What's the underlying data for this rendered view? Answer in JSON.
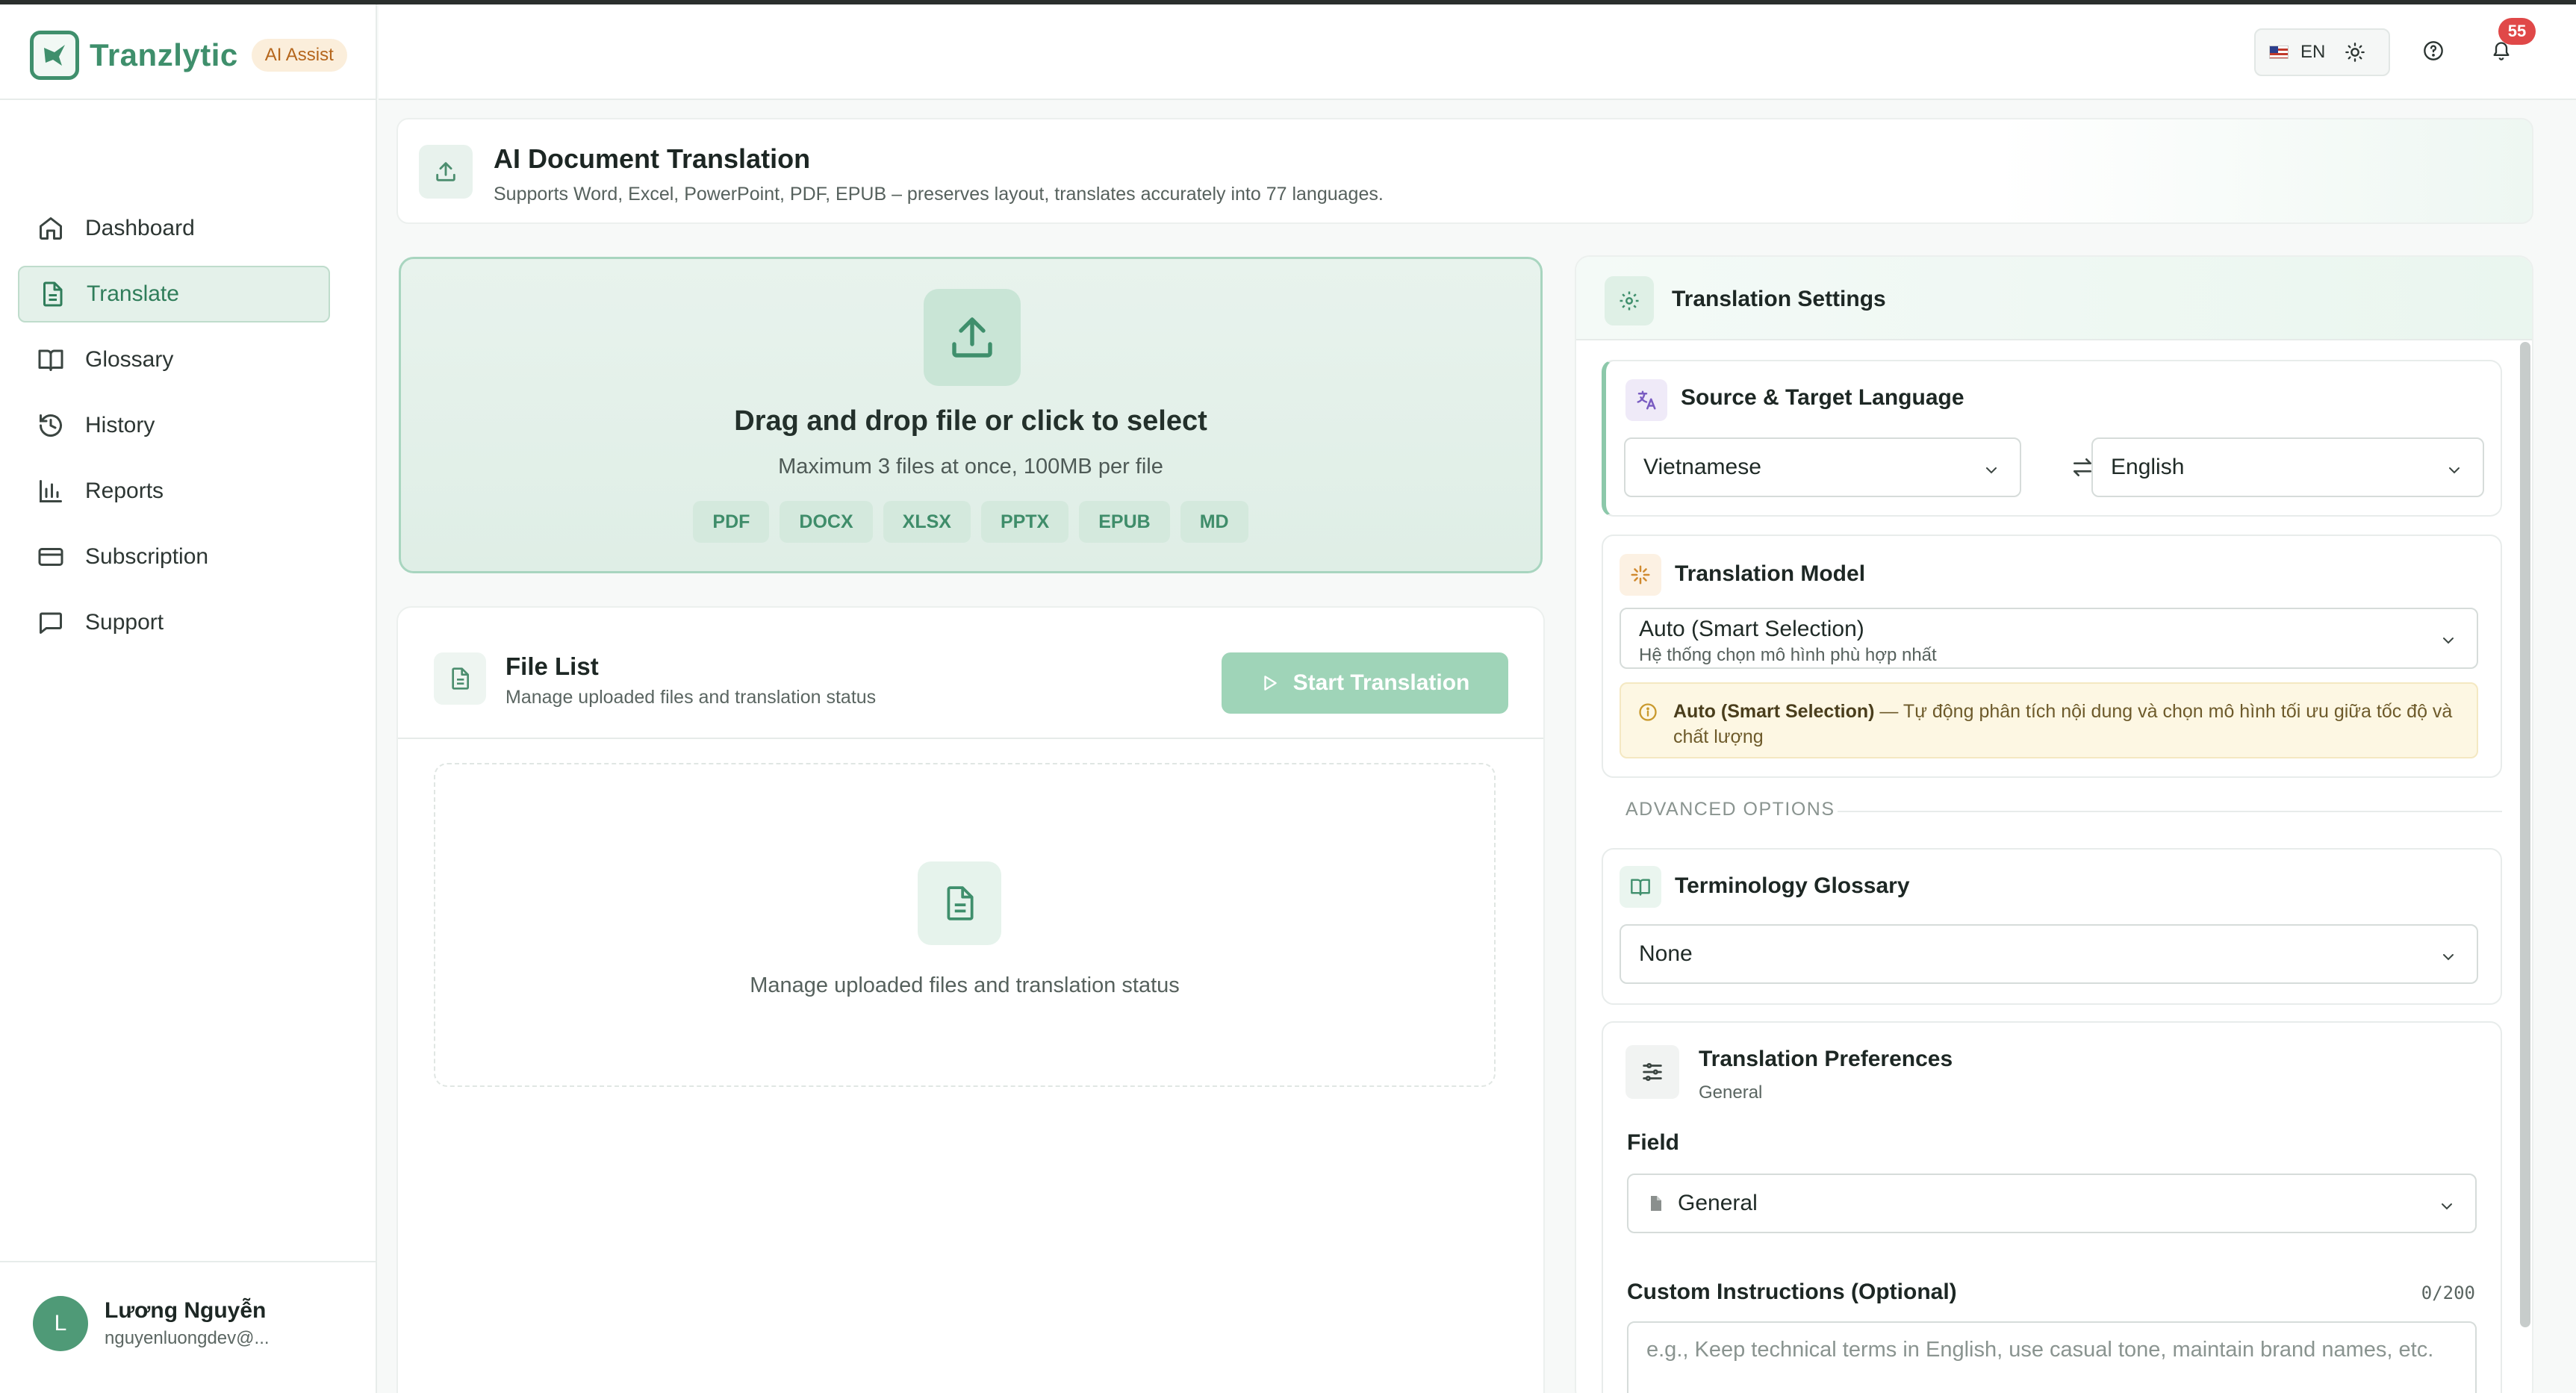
{
  "brand": {
    "name": "Tranzlytic",
    "badge": "AI Assist"
  },
  "nav": [
    {
      "label": "Dashboard",
      "icon": "home-icon",
      "active": false
    },
    {
      "label": "Translate",
      "icon": "file-text-icon",
      "active": true
    },
    {
      "label": "Glossary",
      "icon": "book-icon",
      "active": false
    },
    {
      "label": "History",
      "icon": "history-icon",
      "active": false
    },
    {
      "label": "Reports",
      "icon": "bar-chart-icon",
      "active": false
    },
    {
      "label": "Subscription",
      "icon": "credit-card-icon",
      "active": false
    },
    {
      "label": "Support",
      "icon": "message-icon",
      "active": false
    }
  ],
  "user": {
    "initial": "L",
    "name": "Lương Nguyễn",
    "email": "nguyenluongdev@..."
  },
  "header": {
    "lang": "EN",
    "notifications": "55"
  },
  "banner": {
    "title": "AI Document Translation",
    "subtitle": "Supports Word, Excel, PowerPoint, PDF, EPUB – preserves layout, translates accurately into 77 languages."
  },
  "upload": {
    "title": "Drag and drop file or click to select",
    "subtitle": "Maximum 3 files at once, 100MB per file",
    "formats": [
      "PDF",
      "DOCX",
      "XLSX",
      "PPTX",
      "EPUB",
      "MD"
    ]
  },
  "filelist": {
    "title": "File List",
    "subtitle": "Manage uploaded files and translation status",
    "start_label": "Start Translation",
    "empty_text": "Manage uploaded files and translation status"
  },
  "settings": {
    "title": "Translation Settings",
    "lang": {
      "title": "Source & Target Language",
      "source": "Vietnamese",
      "target": "English"
    },
    "model": {
      "title": "Translation Model",
      "value": "Auto (Smart Selection)",
      "value_sub": "Hệ thống chọn mô hình phù hợp nhất",
      "info_bold": "Auto (Smart Selection)",
      "info_text": " — Tự động phân tích nội dung và chọn mô hình tối ưu giữa tốc độ và chất lượng"
    },
    "advanced_label": "ADVANCED OPTIONS",
    "glossary": {
      "title": "Terminology Glossary",
      "value": "None"
    },
    "preferences": {
      "title": "Translation Preferences",
      "subtitle": "General",
      "field_label": "Field",
      "field_value": "General",
      "custom_label": "Custom Instructions (Optional)",
      "custom_count": "0/200",
      "custom_placeholder": "e.g., Keep technical terms in English, use casual tone, maintain brand names, etc."
    }
  },
  "colors": {
    "accent": "#3f8f6c",
    "active_bg": "#e4f1ea",
    "button_disabled": "#9fd4b8",
    "badge": "#e04848"
  }
}
